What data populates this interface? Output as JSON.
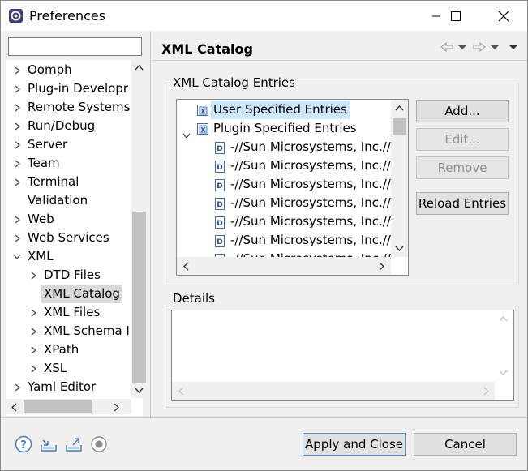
{
  "window": {
    "title": "Preferences"
  },
  "filter": {
    "value": ""
  },
  "tree": [
    {
      "label": "Oomph",
      "expander": ">",
      "indent": 0
    },
    {
      "label": "Plug-in Developr",
      "expander": ">",
      "indent": 0
    },
    {
      "label": "Remote Systems",
      "expander": ">",
      "indent": 0
    },
    {
      "label": "Run/Debug",
      "expander": ">",
      "indent": 0
    },
    {
      "label": "Server",
      "expander": ">",
      "indent": 0
    },
    {
      "label": "Team",
      "expander": ">",
      "indent": 0
    },
    {
      "label": "Terminal",
      "expander": ">",
      "indent": 0
    },
    {
      "label": "Validation",
      "expander": "",
      "indent": 0
    },
    {
      "label": "Web",
      "expander": ">",
      "indent": 0
    },
    {
      "label": "Web Services",
      "expander": ">",
      "indent": 0
    },
    {
      "label": "XML",
      "expander": "v",
      "indent": 0
    },
    {
      "label": "DTD Files",
      "expander": ">",
      "indent": 1
    },
    {
      "label": "XML Catalog",
      "expander": "",
      "indent": 1,
      "selected": true
    },
    {
      "label": "XML Files",
      "expander": ">",
      "indent": 1
    },
    {
      "label": "XML Schema I",
      "expander": ">",
      "indent": 1
    },
    {
      "label": "XPath",
      "expander": ">",
      "indent": 1
    },
    {
      "label": "XSL",
      "expander": ">",
      "indent": 1
    },
    {
      "label": "Yaml Editor",
      "expander": ">",
      "indent": 0
    }
  ],
  "page": {
    "title": "XML Catalog"
  },
  "entries_group": {
    "label": "XML Catalog Entries",
    "items": [
      {
        "label": "User Specified Entries",
        "kind": "root",
        "selected": true
      },
      {
        "label": "Plugin Specified Entries",
        "kind": "root-open"
      },
      {
        "label": "-//Sun Microsystems, Inc.//I",
        "kind": "child"
      },
      {
        "label": "-//Sun Microsystems, Inc.//I",
        "kind": "child"
      },
      {
        "label": "-//Sun Microsystems, Inc.//I",
        "kind": "child"
      },
      {
        "label": "-//Sun Microsystems, Inc.//I",
        "kind": "child"
      },
      {
        "label": "-//Sun Microsystems, Inc.//I",
        "kind": "child"
      },
      {
        "label": "-//Sun Microsystems, Inc.//I",
        "kind": "child"
      },
      {
        "label": "-//Sun Microsystems, Inc.//I",
        "kind": "child"
      }
    ]
  },
  "buttons": {
    "add": "Add...",
    "edit": "Edit...",
    "remove": "Remove",
    "reload": "Reload Entries",
    "apply_close": "Apply and Close",
    "cancel": "Cancel"
  },
  "details_group": {
    "label": "Details"
  },
  "colors": {
    "selection": "#cce8ff",
    "tree_selection": "#d9d9d9"
  }
}
